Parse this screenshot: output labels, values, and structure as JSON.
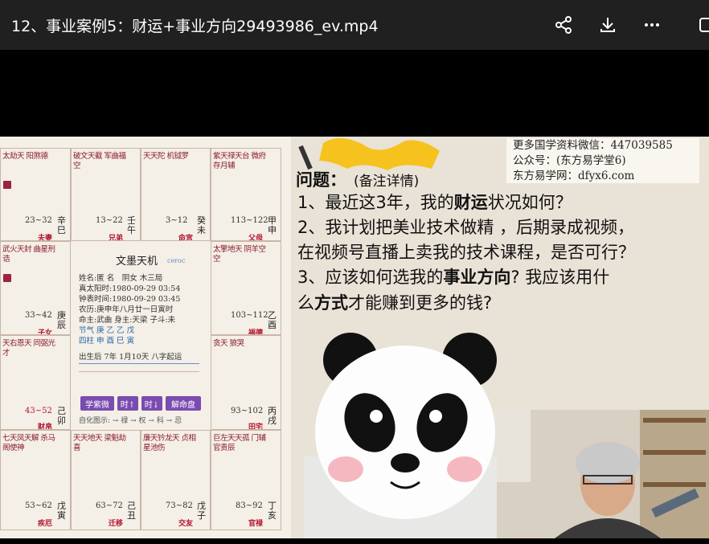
{
  "header": {
    "title": "12、事业案例5：财运+事业方向29493986_ev.mp4",
    "share_label": "share",
    "download_label": "download",
    "more_label": "more",
    "icons": [
      "share-icon",
      "download-icon",
      "more-icon",
      "window-icon"
    ]
  },
  "video": {
    "info": {
      "line1": "更多国学资料微信：447039585",
      "line2": "公众号：(东方易学堂6)",
      "line3": "东方易学网：dfyx6.com"
    },
    "question": {
      "heading": "问题：",
      "note": "(备注详情)",
      "q1_pre": "1、最近这3年，我的",
      "q1_bold": "财运",
      "q1_post": "状况如何？",
      "q2_a": "2、我计划把美业技术做精 ，后期录成视频，",
      "q2_b": "在视频号直播上卖我的技术课程，是否可行？",
      "q3_pre": "3、应该如何选我的",
      "q3_bold": "事业方向",
      "q3_post": "? 我应该用什",
      "q3_b_pre": "么",
      "q3_b_bold": "方式",
      "q3_b_post": "才能赚到更多的钱?"
    },
    "chart": {
      "center_title": "文墨天机",
      "center_sub": "ceroc",
      "rows": [
        "姓名:匿 名　阴女 木三局",
        "真太阳时:1980-09-29 03:54",
        "钟表时间:1980-09-29 03:45",
        "农历:庚申年八月廿一日寅时",
        "命主:武曲 身主:天梁 子斗:未",
        "节气  庚  乙  乙  戊",
        "四柱  申  酉  巳  寅",
        "出生后 7年 1月10天 八字起运"
      ],
      "buttons": [
        "学紫微",
        "时↑",
        "时↓",
        "解命盘"
      ],
      "footer": "自化图示: → 禄 → 权 → 科 → 忌",
      "cells": [
        {
          "stars": "太劫天 阳煞德",
          "range": "23~32",
          "stem": "辛巳",
          "palace": "夫妻"
        },
        {
          "stars": "破文天截 军曲福空",
          "range": "13~22",
          "stem": "壬午",
          "palace": "兄弟"
        },
        {
          "stars": "天天陀 机钺罗",
          "range": "3~12",
          "stem": "癸未",
          "palace": "命宫"
        },
        {
          "stars": "紫天禄天台 微府存月辅",
          "range": "113~122",
          "stem": "甲申",
          "palace": "父母"
        },
        {
          "stars": "武火天封 曲星刑诰",
          "range": "33~42",
          "stem": "庚辰",
          "palace": "子女"
        },
        {
          "stars": "太擎地天 阴羊空空",
          "range": "103~112",
          "stem": "乙酉",
          "palace": "福德"
        },
        {
          "stars": "天右恩天 同弼光才",
          "range": "43~52",
          "stem": "己卯",
          "palace": "财帛"
        },
        {
          "stars": "贪天 狼哭",
          "range": "93~102",
          "stem": "丙戌",
          "palace": "田宅"
        },
        {
          "stars": "七天凤天解 杀马阁使神",
          "range": "53~62",
          "stem": "戊寅",
          "palace": "疾厄"
        },
        {
          "stars": "天天地天 梁魁劫喜",
          "range": "63~72",
          "stem": "己丑",
          "palace": "迁移"
        },
        {
          "stars": "廉天钤龙天 贞相星池伤",
          "range": "73~82",
          "stem": "戊子",
          "palace": "交友"
        },
        {
          "stars": "巨左天天孤 门辅官贵辰",
          "range": "83~92",
          "stem": "丁亥",
          "palace": "官禄"
        }
      ]
    }
  },
  "colors": {
    "header_bg": "#202020",
    "palace_red": "#b3122e",
    "button_purple": "#7a4bb0"
  }
}
